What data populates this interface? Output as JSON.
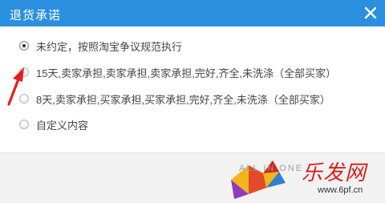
{
  "dialog": {
    "title": "退货承诺"
  },
  "options": [
    {
      "label": "未约定，按照淘宝争议规范执行",
      "checked": true
    },
    {
      "label": "15天,卖家承担,卖家承担,卖家承担,完好,齐全,未洗涤（全部买家）",
      "checked": false
    },
    {
      "label": "8天,卖家承担,买家承担,买家承担,完好,齐全,未洗涤（全部买家）",
      "checked": false
    },
    {
      "label": "自定义内容",
      "checked": false
    }
  ],
  "watermark": {
    "text": "ALL IN ONE",
    "chinese": "乐发网",
    "url": "www.6pf.cn"
  },
  "colors": {
    "titlebar": "#2b8fe0",
    "arrow": "#e02020",
    "footer": "#f2f2f2"
  }
}
